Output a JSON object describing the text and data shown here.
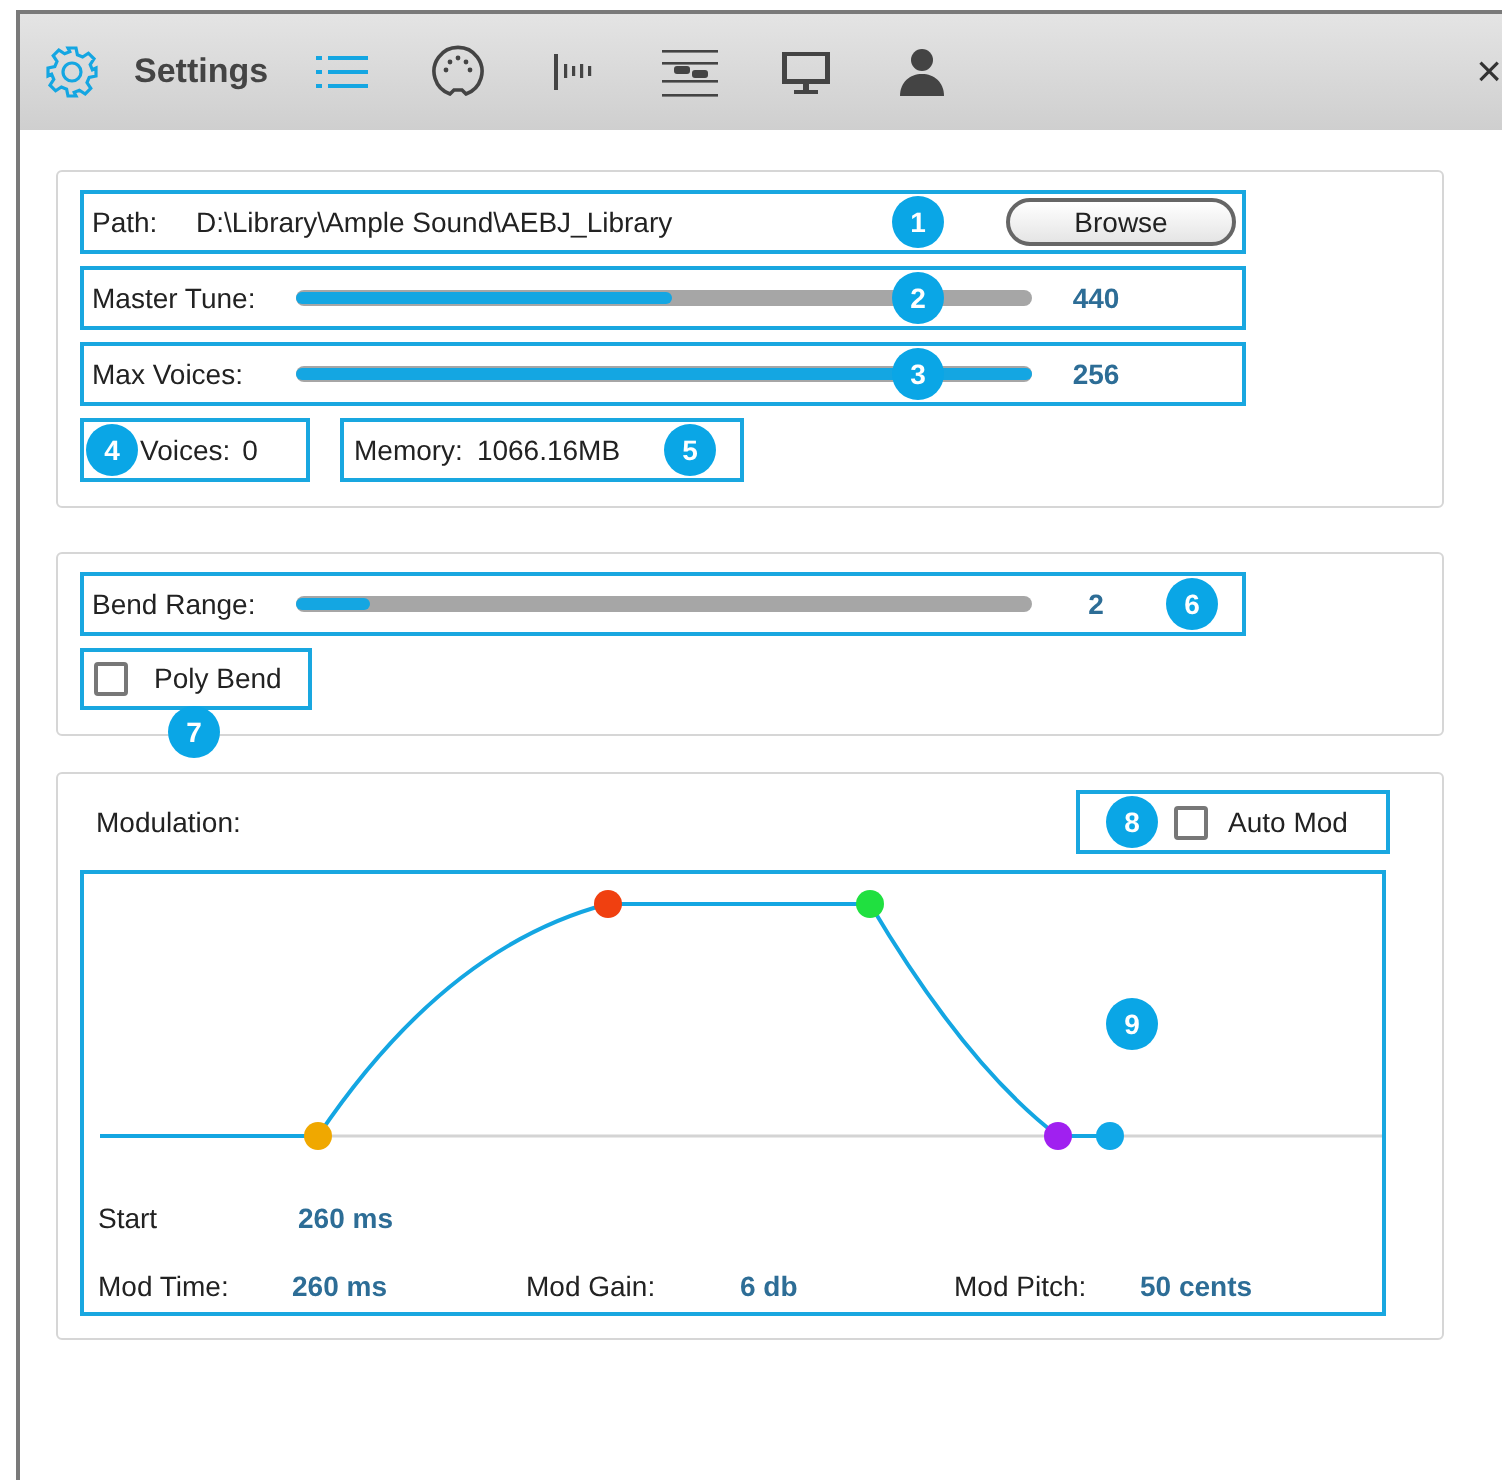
{
  "toolbar": {
    "title": "Settings",
    "tabs": [
      {
        "kind": "list",
        "selected": true
      },
      {
        "kind": "midi",
        "selected": false
      },
      {
        "kind": "bars",
        "selected": false
      },
      {
        "kind": "mixer",
        "selected": false
      },
      {
        "kind": "monitor",
        "selected": false
      },
      {
        "kind": "user",
        "selected": false
      }
    ],
    "close": "×"
  },
  "general": {
    "path": {
      "label": "Path:",
      "value": "D:\\Library\\Ample Sound\\AEBJ_Library",
      "button": "Browse",
      "badge": "1"
    },
    "sliders": [
      {
        "label": "Master Tune:",
        "level": 0.51,
        "reading": "440",
        "badge": "2"
      },
      {
        "label": "Max Voices:",
        "level": 1.0,
        "reading": "256",
        "badge": "3"
      }
    ],
    "voices": {
      "label": "Voices:",
      "value": "0",
      "badge": "4"
    },
    "memory": {
      "label": "Memory:",
      "value": "1066.16MB",
      "badge": "5"
    }
  },
  "bend": {
    "slider": {
      "label": "Bend Range:",
      "level": 0.1,
      "reading": "2",
      "badge": "6"
    },
    "poly_bend": {
      "label": "Poly Bend",
      "checked": false,
      "badge": "7"
    }
  },
  "modulation": {
    "title": "Modulation:",
    "auto_mod": {
      "label": "Auto Mod",
      "checked": false,
      "badge": "8"
    },
    "envelope": {
      "badge": "9",
      "points": [
        {
          "color": "#f0a800"
        },
        {
          "color": "#f04010"
        },
        {
          "color": "#20e040"
        },
        {
          "color": "#a020f0"
        },
        {
          "color": "#10a8e8"
        }
      ]
    },
    "start": {
      "label": "Start",
      "value": "260 ms"
    },
    "params": [
      {
        "label": "Mod Time:",
        "value": "260 ms"
      },
      {
        "label": "Mod Gain:",
        "value": "6 db"
      },
      {
        "label": "Mod Pitch:",
        "value": "50 cents"
      }
    ]
  }
}
